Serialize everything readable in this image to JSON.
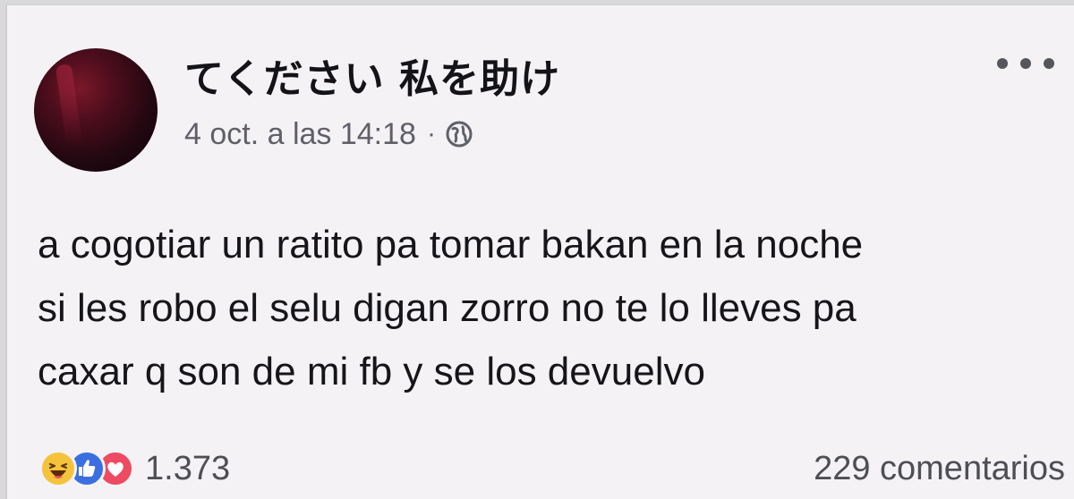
{
  "post": {
    "author": "てください 私を助け",
    "timestamp": "4 oct. a las 14:18",
    "separator": "·",
    "privacy_icon": "globe-icon",
    "more_icon": "more-options-icon",
    "body_lines": [
      "a cogotiar un ratito pa tomar bakan en la noche",
      "si les robo el selu digan zorro no te lo lleves pa",
      "caxar q son de mi fb y se los devuelvo"
    ]
  },
  "footer": {
    "reaction_icons": [
      "haha-icon",
      "like-icon",
      "love-icon"
    ],
    "reaction_count": "1.373",
    "comments": "229 comentarios"
  },
  "colors": {
    "card_background": "#f4f2f5",
    "text": "#16161a",
    "muted_text": "#606068",
    "haha": "#f5c33b",
    "like": "#3b6fe0",
    "love": "#ec4b61"
  }
}
